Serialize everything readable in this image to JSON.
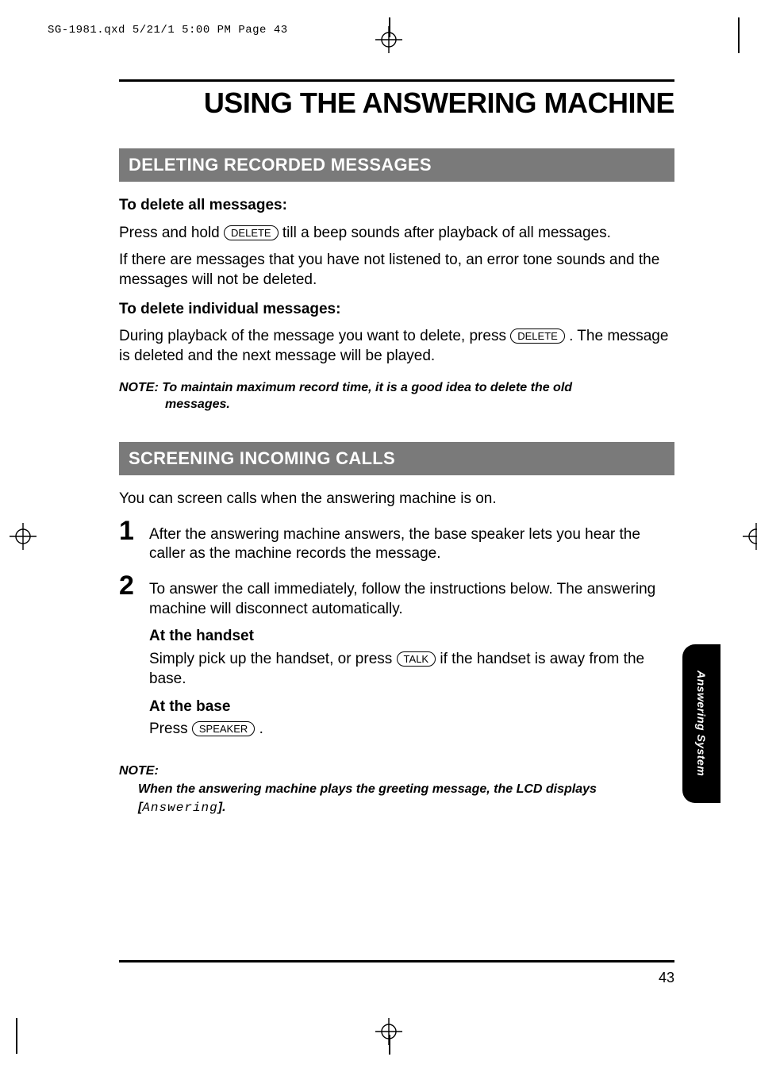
{
  "prepress_header": "SG-1981.qxd  5/21/1 5:00 PM  Page 43",
  "page_title": "USING THE ANSWERING MACHINE",
  "section1": {
    "heading": "DELETING RECORDED MESSAGES",
    "sub1_title": "To delete all messages:",
    "sub1_line1a": "Press and hold ",
    "sub1_key": "DELETE",
    "sub1_line1b": " till a beep sounds after playback of all messages.",
    "sub1_p2": "If there are messages that you have not listened to, an error tone sounds and the messages will not be deleted.",
    "sub2_title": "To delete individual messages:",
    "sub2_line1a": "During playback of the message you want to delete, press ",
    "sub2_key": "DELETE",
    "sub2_line1b": " . The message is deleted and the next message will be played.",
    "note_label": "NOTE: ",
    "note_text1": "To maintain maximum record time, it is a good idea to delete the old",
    "note_text2": "messages."
  },
  "section2": {
    "heading": "SCREENING INCOMING CALLS",
    "intro": "You can screen calls when the answering machine is on.",
    "steps": [
      {
        "num": "1",
        "text": "After the answering machine answers, the base speaker lets you hear the caller as the machine records the message."
      },
      {
        "num": "2",
        "text": "To answer the call immediately, follow the instructions below. The answering machine will disconnect automatically."
      }
    ],
    "handset_h": "At the handset",
    "handset_a": "Simply pick up the handset, or press ",
    "handset_key": "TALK",
    "handset_b": " if the handset is away from the base.",
    "base_h": "At the base",
    "base_a": "Press ",
    "base_key": "SPEAKER",
    "base_b": " .",
    "note2_label": "NOTE:",
    "note2_line": "When the answering machine plays the greeting message, the LCD displays",
    "note2_br_open": "[",
    "note2_lcd": "Answering",
    "note2_br_close": "]."
  },
  "sidetab": "Answering System",
  "page_number": "43"
}
